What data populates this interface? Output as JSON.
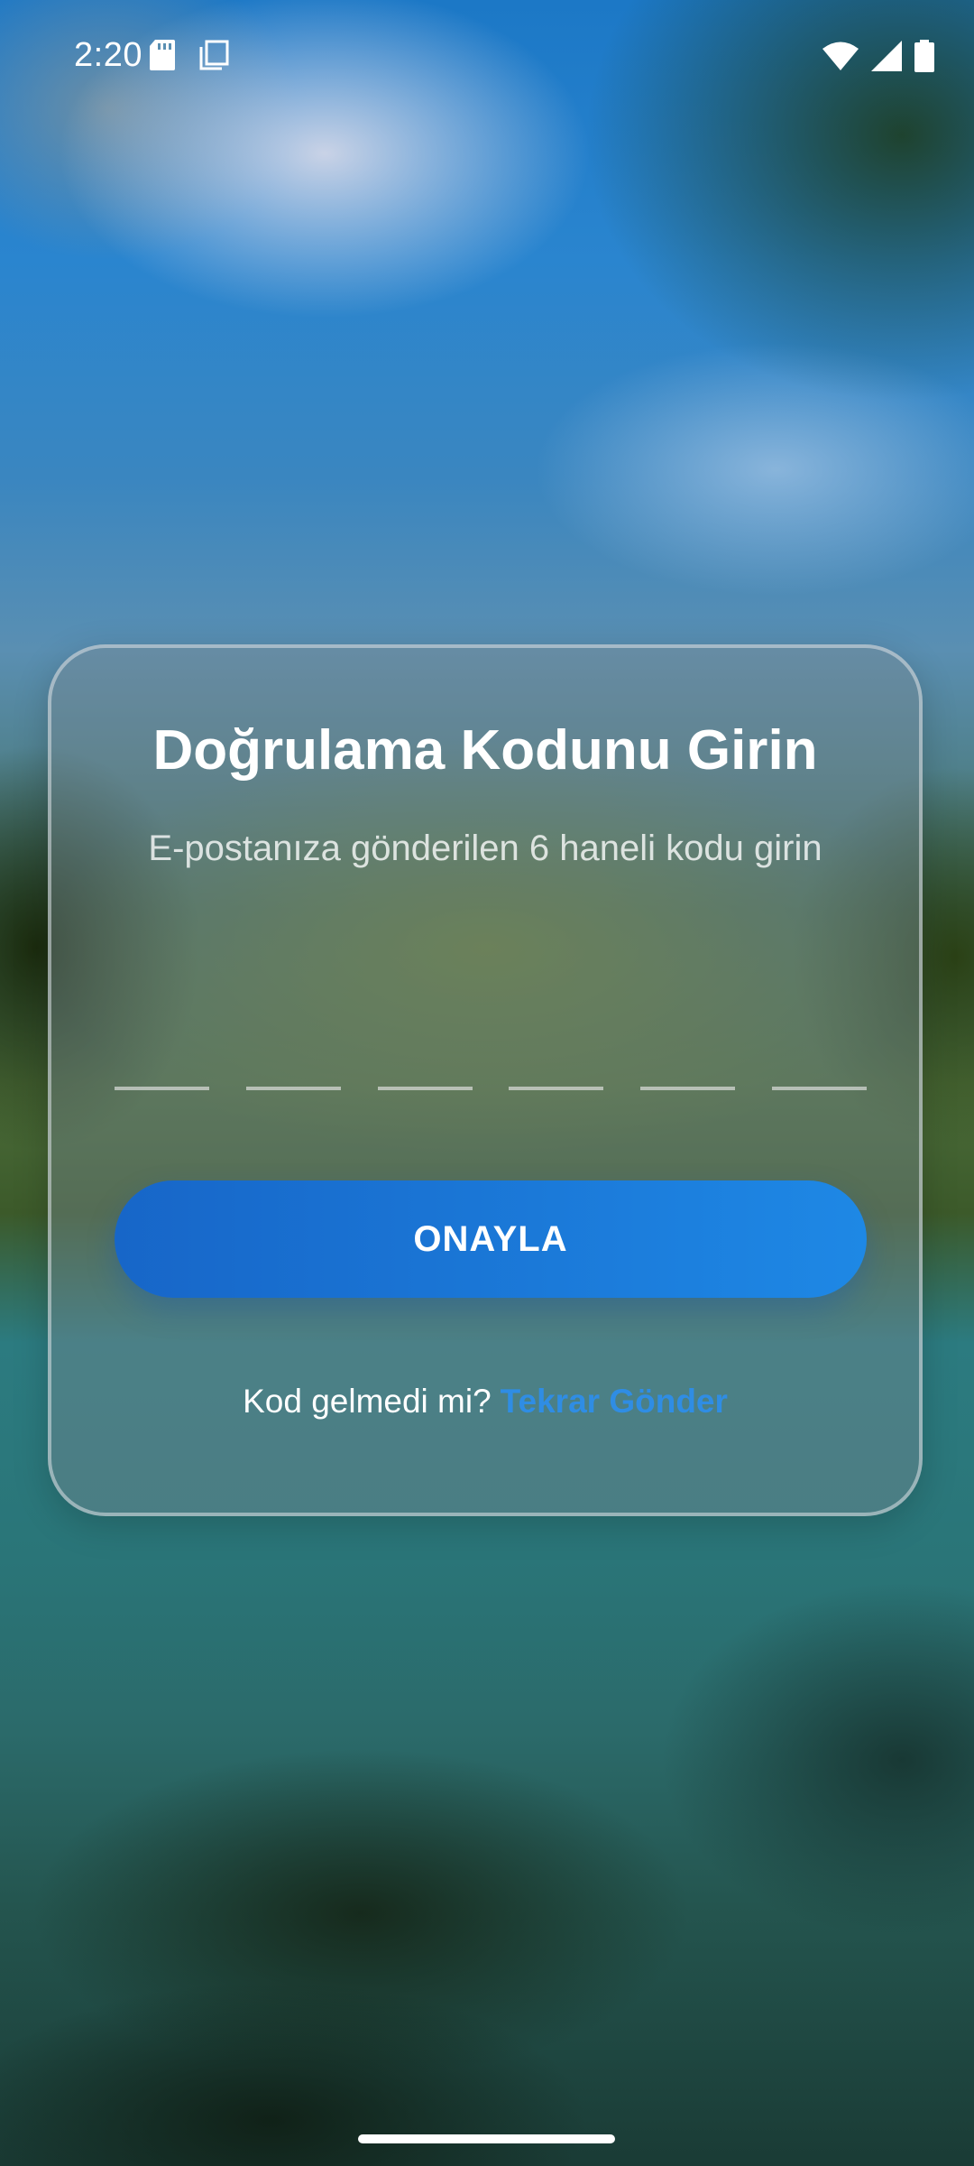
{
  "status_bar": {
    "time": "2:20",
    "left_icons": [
      "sd-card-icon",
      "copy-icon"
    ],
    "right_icons": [
      "wifi-icon",
      "signal-icon",
      "battery-icon"
    ]
  },
  "card": {
    "title": "Doğrulama Kodunu Girin",
    "subtitle": "E-postanıza gönderilen 6 haneli kodu girin",
    "otp_digits": [
      "",
      "",
      "",
      "",
      "",
      ""
    ],
    "confirm_label": "ONAYLA",
    "resend_prompt": "Kod gelmedi mi?",
    "resend_link": "Tekrar Gönder"
  },
  "colors": {
    "accent": "#1E88E5",
    "link": "#2F8DE4",
    "button_start": "#1766C8"
  }
}
